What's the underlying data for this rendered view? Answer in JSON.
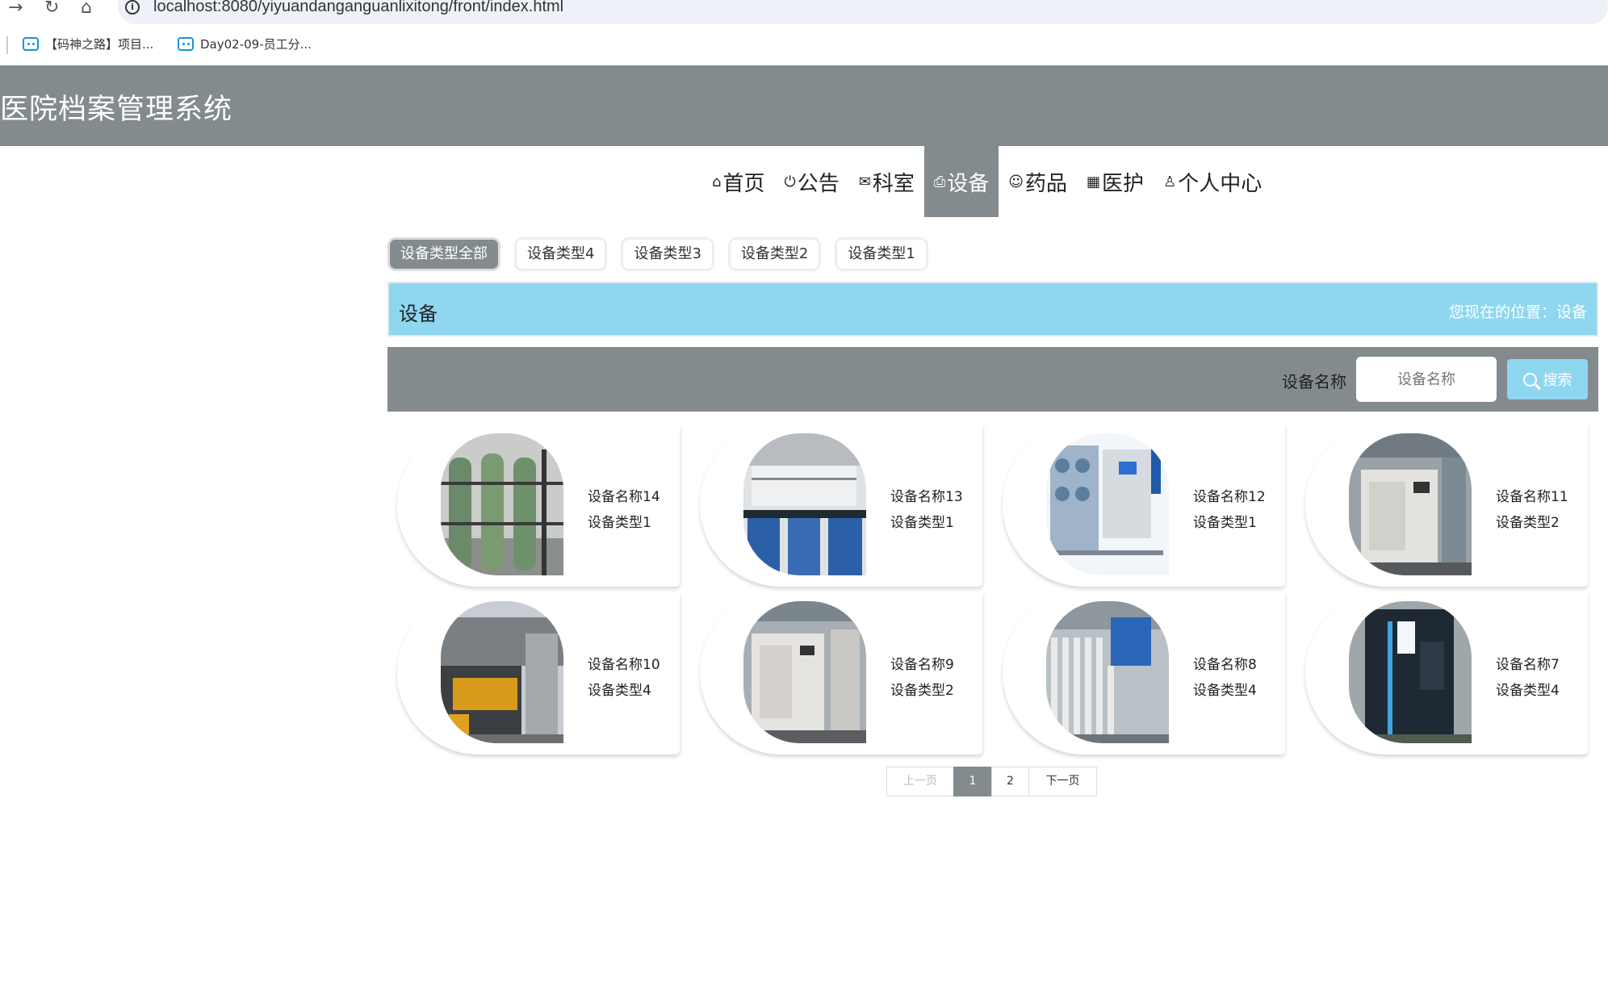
{
  "browser": {
    "url": "localhost:8080/yiyuandanganguanlixitong/front/index.html",
    "bookmarks": [
      {
        "label": "【码神之路】项目..."
      },
      {
        "label": "Day02-09-员工分..."
      }
    ]
  },
  "site": {
    "title": "医院档案管理系统"
  },
  "nav": {
    "items": [
      {
        "label": "首页",
        "icon": "home-icon"
      },
      {
        "label": "公告",
        "icon": "power-icon"
      },
      {
        "label": "科室",
        "icon": "mail-icon"
      },
      {
        "label": "设备",
        "icon": "printer-icon",
        "active": true
      },
      {
        "label": "药品",
        "icon": "palette-icon"
      },
      {
        "label": "医护",
        "icon": "grid-icon"
      },
      {
        "label": "个人中心",
        "icon": "user-icon"
      }
    ]
  },
  "categories": {
    "items": [
      {
        "label": "设备类型全部",
        "active": true
      },
      {
        "label": "设备类型4"
      },
      {
        "label": "设备类型3"
      },
      {
        "label": "设备类型2"
      },
      {
        "label": "设备类型1"
      }
    ]
  },
  "pagebar": {
    "title": "设备",
    "location": "您现在的位置：设备"
  },
  "search": {
    "label": "设备名称",
    "placeholder": "设备名称",
    "button_label": "搜索"
  },
  "equipment": [
    {
      "name": "设备名称14",
      "type": "设备类型1"
    },
    {
      "name": "设备名称13",
      "type": "设备类型1"
    },
    {
      "name": "设备名称12",
      "type": "设备类型1"
    },
    {
      "name": "设备名称11",
      "type": "设备类型2"
    },
    {
      "name": "设备名称10",
      "type": "设备类型4"
    },
    {
      "name": "设备名称9",
      "type": "设备类型2"
    },
    {
      "name": "设备名称8",
      "type": "设备类型4"
    },
    {
      "name": "设备名称7",
      "type": "设备类型4"
    }
  ],
  "pagination": {
    "prev_label": "上一页",
    "pages": [
      "1",
      "2"
    ],
    "current": "1",
    "next_label": "下一页"
  },
  "colors": {
    "header": "#838b8e",
    "accent_blue": "#8fd6f1"
  }
}
